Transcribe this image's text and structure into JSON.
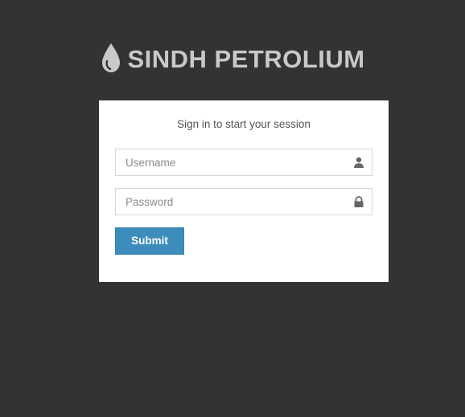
{
  "brand": {
    "name": "SINDH PETROLIUM",
    "logo_icon": "oil-drop-icon"
  },
  "login": {
    "message": "Sign in to start your session",
    "username_placeholder": "Username",
    "username_icon": "user-icon",
    "password_placeholder": "Password",
    "password_icon": "lock-icon",
    "submit_label": "Submit"
  },
  "colors": {
    "background": "#333333",
    "box": "#ffffff",
    "button": "#3c8dbc",
    "brand_text": "#c9c9c9"
  }
}
